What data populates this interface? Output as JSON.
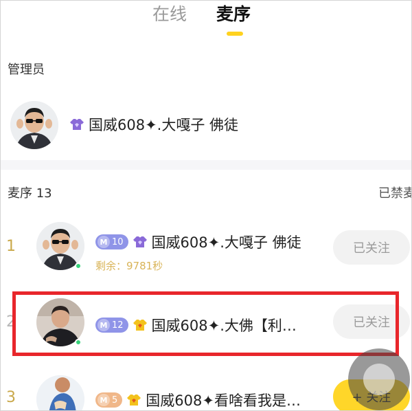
{
  "tabs": {
    "online": "在线",
    "queue": "麦序",
    "active": "queue"
  },
  "admin": {
    "section_label": "管理员",
    "name": "国威608✦.大嘎子 佛徒",
    "badge_icon": "purple-vip-shirt-icon"
  },
  "queue": {
    "label": "麦序 13",
    "banned_label": "已禁麦",
    "rows": [
      {
        "rank": "1",
        "level": "10",
        "level_color": "#8f94e8",
        "badge_icon": "purple-vip-shirt-icon",
        "name": "国威608✦.大嘎子 佛徒",
        "remaining": "剩余：9781秒",
        "follow_label": "已关注",
        "online": true
      },
      {
        "rank": "2",
        "level": "12",
        "level_color": "#8f94e8",
        "badge_icon": "gold-vip-shirt-icon",
        "name": "国威608✦.大佛【利…",
        "follow_label": "已关注",
        "online": true
      },
      {
        "rank": "3",
        "level": "5",
        "level_color": "#f0b789",
        "badge_icon": "gold-vip-shirt-icon",
        "name": "国威608✦看啥看我是…",
        "follow_label": "+ 关注"
      }
    ]
  },
  "colors": {
    "accent": "#ffd21f",
    "highlight": "#e8262b",
    "online_dot": "#37d27a",
    "rank_gold": "#c9a84a"
  }
}
